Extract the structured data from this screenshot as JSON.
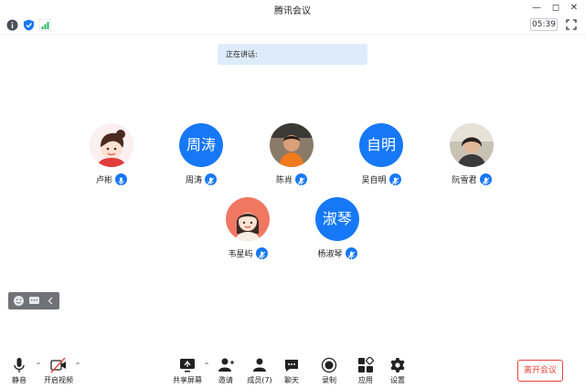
{
  "window": {
    "title": "腾讯会议"
  },
  "infobar": {
    "timer": "05:39"
  },
  "speaking": {
    "label": "正在讲话:"
  },
  "participants": [
    {
      "name": "卢彬",
      "avatar_text": ""
    },
    {
      "name": "周涛",
      "avatar_text": "周涛"
    },
    {
      "name": "陈肖",
      "avatar_text": ""
    },
    {
      "name": "吴自明",
      "avatar_text": "自明"
    },
    {
      "name": "阮雪君",
      "avatar_text": ""
    },
    {
      "name": "韦星屿",
      "avatar_text": ""
    },
    {
      "name": "杨淑琴",
      "avatar_text": "淑琴"
    }
  ],
  "toolbar": {
    "mute": "静音",
    "video": "开启视频",
    "share": "共享屏幕",
    "invite": "邀请",
    "members": "成员(7)",
    "chat": "聊天",
    "record": "录制",
    "apps": "应用",
    "settings": "设置",
    "leave": "离开会议"
  },
  "colors": {
    "accent": "#1678f5",
    "leave": "#e8433d",
    "banner": "#deebfa"
  }
}
